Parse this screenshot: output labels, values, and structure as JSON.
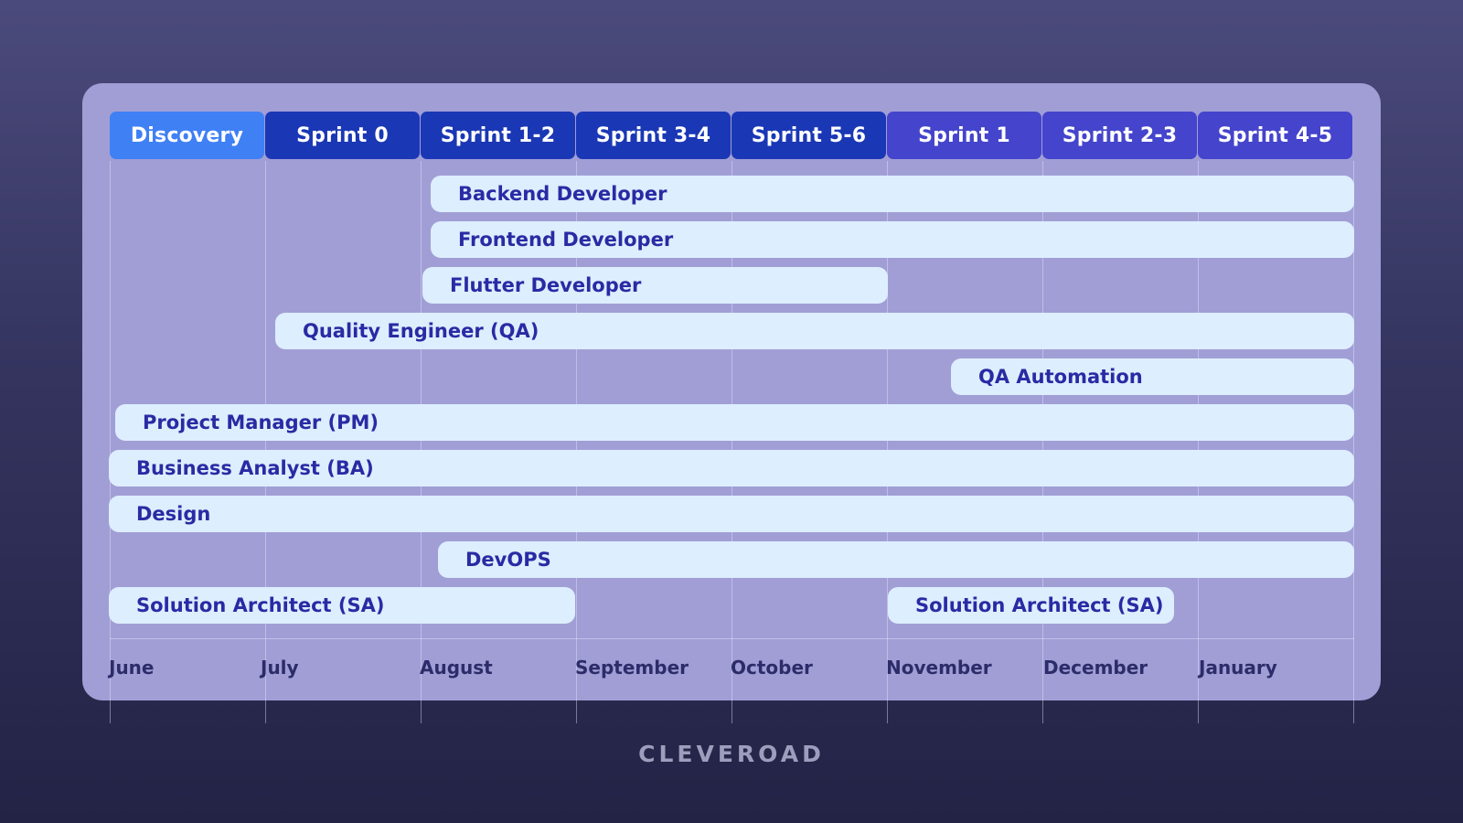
{
  "diagram": {
    "phases": [
      {
        "label": "Discovery",
        "color": "#3f80f4"
      },
      {
        "label": "Sprint 0",
        "color": "#1a37b5"
      },
      {
        "label": "Sprint 1-2",
        "color": "#1a37b5"
      },
      {
        "label": "Sprint 3-4",
        "color": "#1a37b5"
      },
      {
        "label": "Sprint 5-6",
        "color": "#1a37b5"
      },
      {
        "label": "Sprint 1",
        "color": "#4444cc"
      },
      {
        "label": "Sprint 2-3",
        "color": "#4444cc"
      },
      {
        "label": "Sprint 4-5",
        "color": "#4444cc"
      }
    ],
    "roles": [
      {
        "label": "Backend Developer"
      },
      {
        "label": "Frontend Developer"
      },
      {
        "label": "Flutter Developer"
      },
      {
        "label": "Quality Engineer (QA)"
      },
      {
        "label": "QA Automation"
      },
      {
        "label": "Project Manager (PM)"
      },
      {
        "label": "Business Analyst (BA)"
      },
      {
        "label": "Design"
      },
      {
        "label": "DevOPS"
      },
      {
        "label": "Solution Architect (SA)"
      },
      {
        "label": "Solution Architect (SA)"
      }
    ],
    "months": [
      "June",
      "July",
      "August",
      "September",
      "October",
      "November",
      "December",
      "January"
    ]
  },
  "brand": {
    "logo_text": "CLEVEROAD"
  },
  "colors": {
    "background": "#34345f",
    "card": "#a19ed6",
    "bar_fill": "#ddeefe",
    "bar_text": "#2a2aa4",
    "month_text": "#2c2c6a"
  }
}
